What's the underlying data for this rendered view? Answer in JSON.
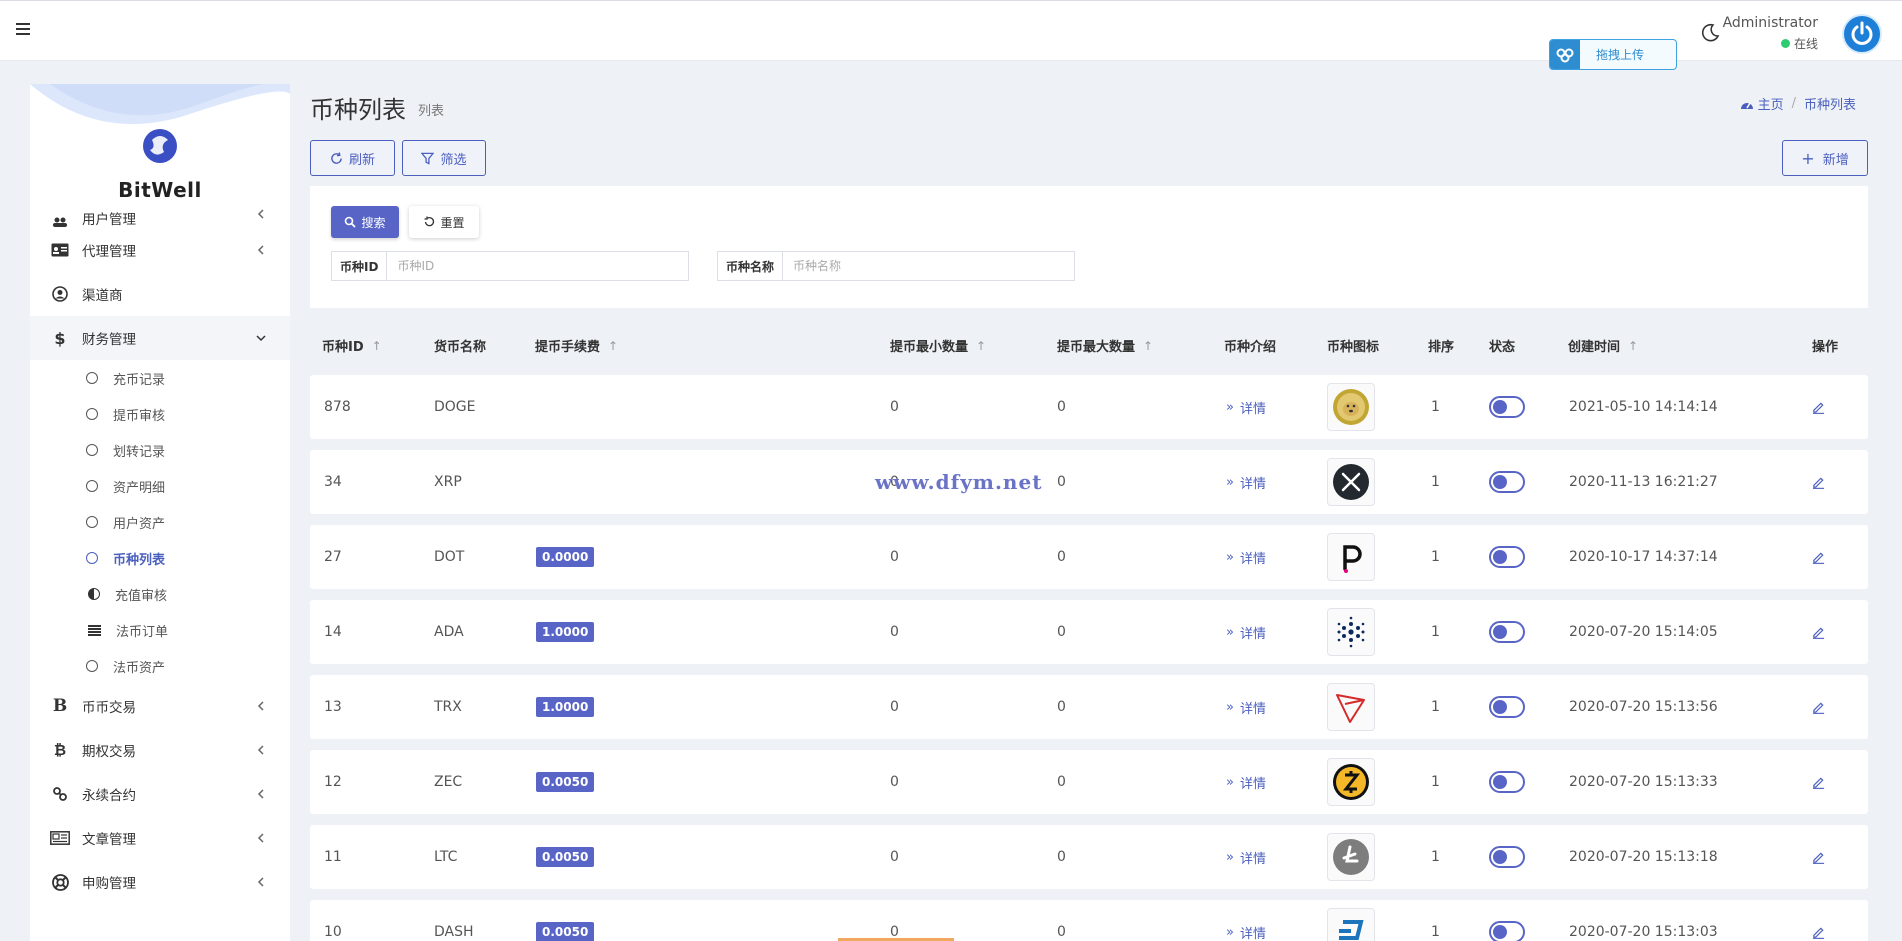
{
  "topbar": {
    "upload_label": "拖拽上传",
    "admin_name": "Administrator",
    "admin_status": "在线"
  },
  "sidebar": {
    "brand_name": "BitWell",
    "cut_top_label": "用户管理",
    "items": [
      {
        "label": "代理管理",
        "icon": "id-card-icon"
      },
      {
        "label": "渠道商",
        "icon": "user-circle-icon"
      },
      {
        "label": "财务管理",
        "icon": "dollar-icon"
      }
    ],
    "finance_sub": [
      {
        "label": "充币记录"
      },
      {
        "label": "提币审核"
      },
      {
        "label": "划转记录"
      },
      {
        "label": "资产明细"
      },
      {
        "label": "用户资产"
      },
      {
        "label": "币种列表"
      },
      {
        "label": "充值审核"
      },
      {
        "label": "法币订单"
      },
      {
        "label": "法币资产"
      }
    ],
    "items_after": [
      {
        "label": "币币交易",
        "icon": "bitcoin-b-icon"
      },
      {
        "label": "期权交易",
        "icon": "bitcoin-icon"
      },
      {
        "label": "永续合约",
        "icon": "link-icon"
      },
      {
        "label": "文章管理",
        "icon": "newspaper-icon"
      },
      {
        "label": "申购管理",
        "icon": "lifebuoy-icon"
      }
    ]
  },
  "page": {
    "title": "币种列表",
    "subtitle": "列表",
    "breadcrumb_home": "主页",
    "breadcrumb_current": "币种列表",
    "refresh_label": "刷新",
    "filter_label": "筛选",
    "add_label": "新增"
  },
  "filter": {
    "search_label": "搜索",
    "reset_label": "重置",
    "coin_id_label": "币种ID",
    "coin_id_placeholder": "币种ID",
    "coin_name_label": "币种名称",
    "coin_name_placeholder": "币种名称"
  },
  "table": {
    "headers": {
      "id": "币种ID",
      "name": "货币名称",
      "fee": "提币手续费",
      "min_qty": "提币最小数量",
      "max_qty": "提币最大数量",
      "intro": "币种介绍",
      "icon": "币种图标",
      "sort": "排序",
      "status": "状态",
      "created": "创建时间",
      "action": "操作"
    },
    "detail_label": "详情",
    "rows": [
      {
        "id": "878",
        "name": "DOGE",
        "fee": "",
        "min": "0",
        "max": "0",
        "sort": "1",
        "created": "2021-05-10 14:14:14",
        "icon": "doge"
      },
      {
        "id": "34",
        "name": "XRP",
        "fee": "",
        "min": "0",
        "max": "0",
        "sort": "1",
        "created": "2020-11-13 16:21:27",
        "icon": "xrp"
      },
      {
        "id": "27",
        "name": "DOT",
        "fee": "0.0000",
        "min": "0",
        "max": "0",
        "sort": "1",
        "created": "2020-10-17 14:37:14",
        "icon": "dot"
      },
      {
        "id": "14",
        "name": "ADA",
        "fee": "1.0000",
        "min": "0",
        "max": "0",
        "sort": "1",
        "created": "2020-07-20 15:14:05",
        "icon": "ada"
      },
      {
        "id": "13",
        "name": "TRX",
        "fee": "1.0000",
        "min": "0",
        "max": "0",
        "sort": "1",
        "created": "2020-07-20 15:13:56",
        "icon": "trx"
      },
      {
        "id": "12",
        "name": "ZEC",
        "fee": "0.0050",
        "min": "0",
        "max": "0",
        "sort": "1",
        "created": "2020-07-20 15:13:33",
        "icon": "zec"
      },
      {
        "id": "11",
        "name": "LTC",
        "fee": "0.0050",
        "min": "0",
        "max": "0",
        "sort": "1",
        "created": "2020-07-20 15:13:18",
        "icon": "ltc"
      },
      {
        "id": "10",
        "name": "DASH",
        "fee": "0.0050",
        "min": "0",
        "max": "0",
        "sort": "1",
        "created": "2020-07-20 15:13:03",
        "icon": "dash"
      }
    ]
  },
  "watermark": "www.dfym.net",
  "colors": {
    "accent": "#5865c6",
    "link": "#4b5fbf",
    "online": "#2ecc71"
  }
}
